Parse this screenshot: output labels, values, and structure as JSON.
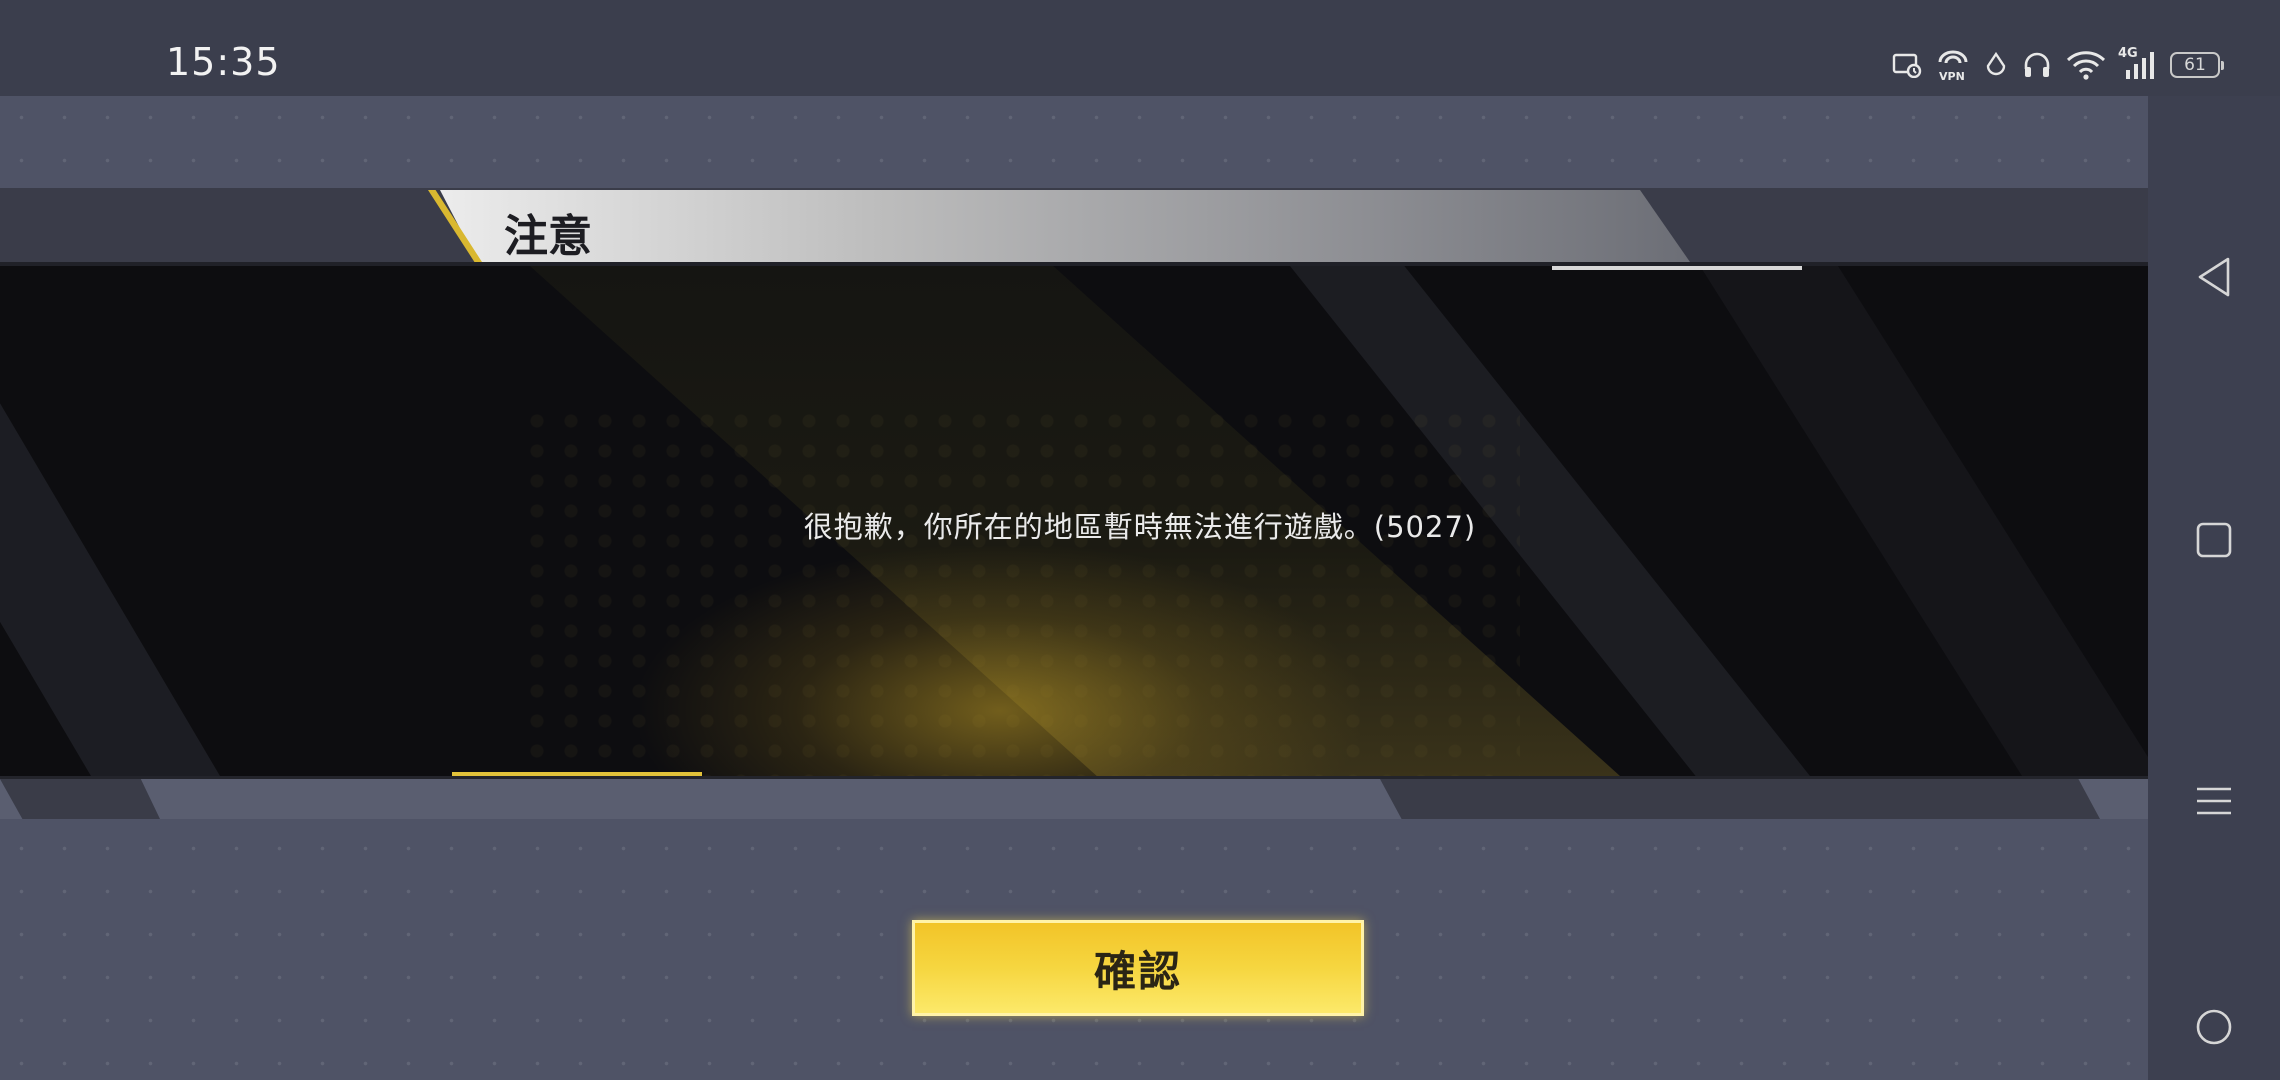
{
  "status_bar": {
    "time": "15:35",
    "icons": [
      "screen-record-icon",
      "vpn-icon",
      "data-saver-icon",
      "headphones-icon",
      "wifi-icon",
      "cellular-4g-icon"
    ],
    "network_label": "4G",
    "battery_level": "61"
  },
  "dialog": {
    "title": "注意",
    "message": "很抱歉，你所在的地區暫時無法進行遊戲。(5027)",
    "confirm_label": "確認",
    "accent_color": "#f4c92d"
  },
  "nav_bar": {
    "items": [
      "back-icon",
      "recents-icon",
      "menu-icon",
      "home-icon"
    ]
  }
}
